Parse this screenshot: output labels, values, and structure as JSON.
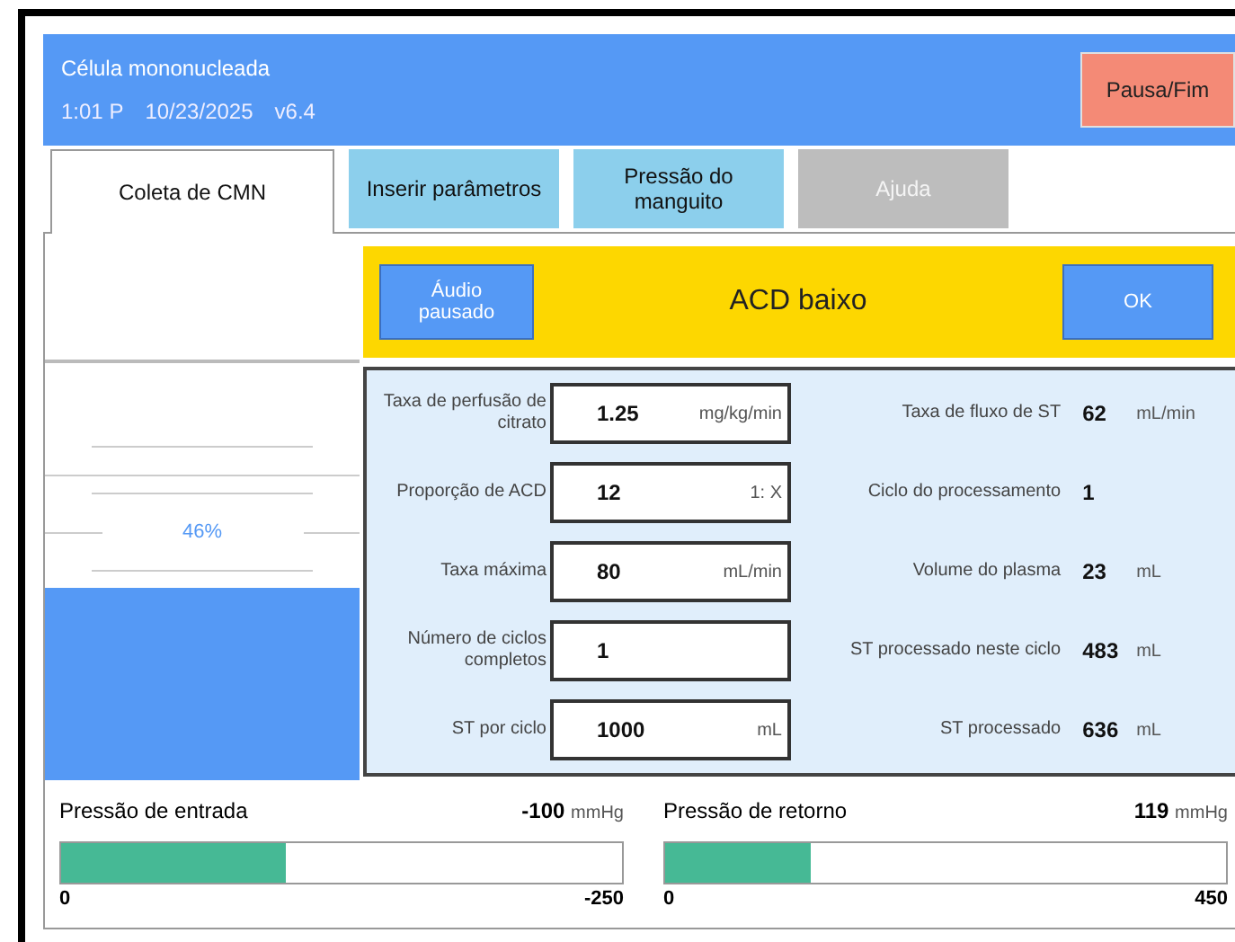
{
  "header": {
    "title": "Célula mononucleada",
    "time": "1:01 P",
    "date": "10/23/2025",
    "version": "v6.4",
    "pause_button": "Pausa/Fim"
  },
  "tabs": [
    {
      "label": "Coleta de CMN",
      "selected": true,
      "disabled": false
    },
    {
      "label": "Inserir parâmetros",
      "selected": false,
      "disabled": false
    },
    {
      "label": "Pressão do manguito",
      "selected": false,
      "disabled": false
    },
    {
      "label": "Ajuda",
      "selected": false,
      "disabled": true
    }
  ],
  "gauge": {
    "level": 0.46,
    "reading": "46%"
  },
  "alert": {
    "audio_button": "Áudio pausado",
    "message": "ACD baixo",
    "ok_button": "OK"
  },
  "settings": [
    {
      "label": "Taxa de perfusão de citrato",
      "value": "1.25",
      "unit": "mg/kg/min"
    },
    {
      "label": "Proporção de ACD",
      "value": "12",
      "unit": "1: X"
    },
    {
      "label": "Taxa máxima",
      "value": "80",
      "unit": "mL/min"
    },
    {
      "label": "Número de ciclos completos",
      "value": "1"
    },
    {
      "label": "ST por ciclo",
      "value": "1000",
      "unit": "mL"
    }
  ],
  "readings": [
    {
      "label": "Taxa de fluxo de ST",
      "value": "62",
      "unit": "mL/min"
    },
    {
      "label": "Ciclo do processamento",
      "value": "1"
    },
    {
      "label": "Volume do plasma",
      "value": "23",
      "unit": "mL"
    },
    {
      "label": "ST processado neste ciclo",
      "value": "483",
      "unit": "mL"
    },
    {
      "label": "ST processado",
      "value": "636",
      "unit": "mL"
    }
  ],
  "pressures": [
    {
      "label": "Pressão de entrada",
      "value": "-100",
      "unit": "mmHg",
      "level": 0.4,
      "min": "0",
      "max": "-250"
    },
    {
      "label": "Pressão de retorno",
      "value": "119",
      "unit": "mmHg",
      "level": 0.26,
      "min": "0",
      "max": "450"
    }
  ]
}
